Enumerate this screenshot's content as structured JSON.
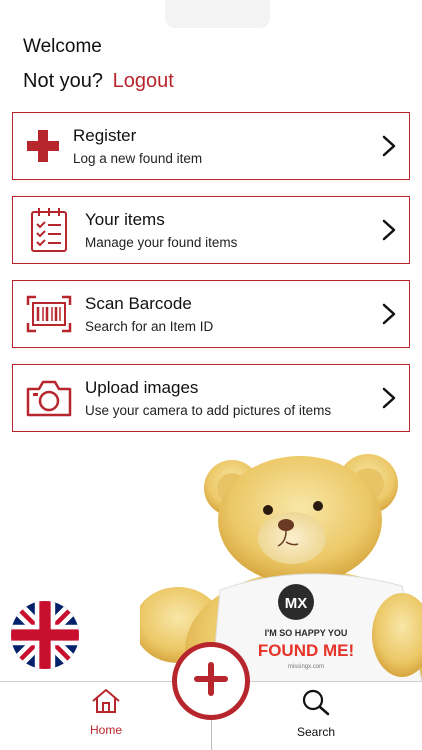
{
  "header": {
    "welcome": "Welcome",
    "not_you": "Not you?",
    "logout": "Logout"
  },
  "menu": [
    {
      "title": "Register",
      "subtitle": "Log a new found item",
      "icon": "plus-icon"
    },
    {
      "title": "Your items",
      "subtitle": "Manage your found items",
      "icon": "checklist-icon"
    },
    {
      "title": "Scan Barcode",
      "subtitle": "Search for an Item ID",
      "icon": "barcode-icon"
    },
    {
      "title": "Upload images",
      "subtitle": "Use your camera to add pictures of items",
      "icon": "camera-icon"
    }
  ],
  "promo": {
    "badge": "MX",
    "shirt_line1": "I'M SO HAPPY YOU",
    "shirt_line2": "FOUND ME!",
    "shirt_url": "missingx.com"
  },
  "tabs": {
    "home": "Home",
    "search": "Search"
  },
  "language": "flag-uk-icon",
  "colors": {
    "accent": "#b8262d",
    "text": "#111111",
    "border": "#cfcfcf"
  }
}
